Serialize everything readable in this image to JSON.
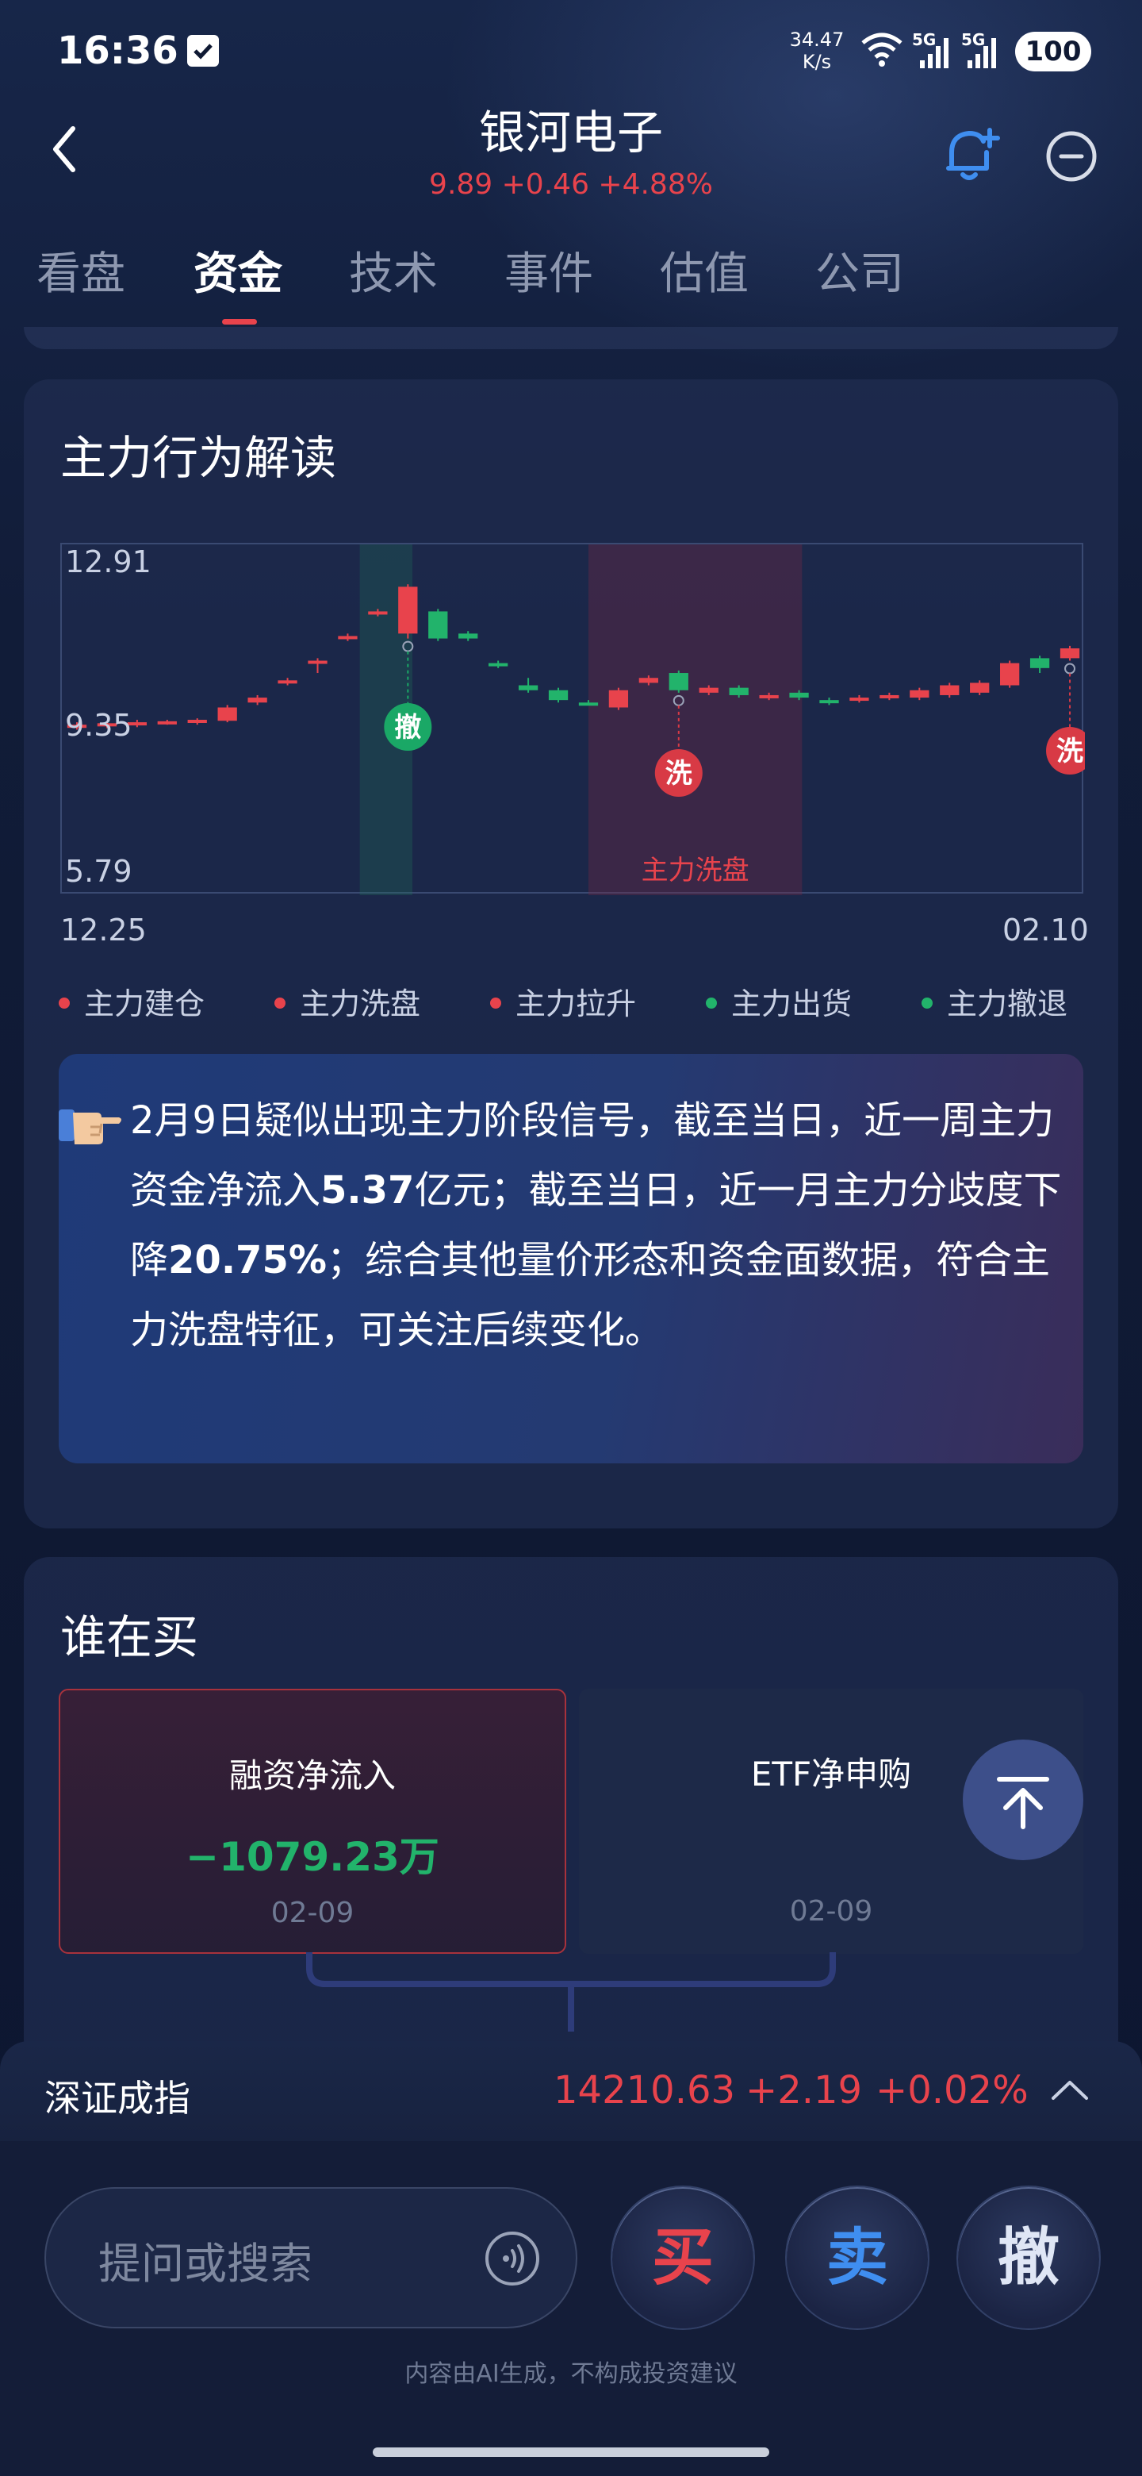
{
  "status": {
    "time": "16:36",
    "net_speed_value": "34.47",
    "net_speed_unit": "K/s",
    "net_type_1": "5G",
    "net_type_2": "5G",
    "battery": "100"
  },
  "header": {
    "title": "银河电子",
    "quote": "9.89 +0.46 +4.88%"
  },
  "tabs": [
    "看盘",
    "资金",
    "技术",
    "事件",
    "估值",
    "公司"
  ],
  "active_tab": "资金",
  "behavior": {
    "title": "主力行为解读",
    "chart_data": {
      "type": "candlestick",
      "y_ticks": [
        "12.91",
        "9.35",
        "5.79"
      ],
      "x_start": "12.25",
      "x_end": "02.10",
      "ylim": [
        5.79,
        12.91
      ],
      "highlight_zone_label": "主力洗盘",
      "markers": [
        {
          "label": "撤",
          "color": "#1aa866"
        },
        {
          "label": "洗",
          "color": "#d83a45"
        },
        {
          "label": "洗",
          "color": "#d83a45"
        }
      ],
      "candles": [
        {
          "o": 9.2,
          "c": 9.25,
          "h": 9.3,
          "l": 9.15
        },
        {
          "o": 9.22,
          "c": 9.28,
          "h": 9.3,
          "l": 9.18
        },
        {
          "o": 9.25,
          "c": 9.3,
          "h": 9.35,
          "l": 9.2
        },
        {
          "o": 9.28,
          "c": 9.32,
          "h": 9.35,
          "l": 9.25
        },
        {
          "o": 9.3,
          "c": 9.35,
          "h": 9.38,
          "l": 9.25
        },
        {
          "o": 9.33,
          "c": 9.6,
          "h": 9.65,
          "l": 9.3
        },
        {
          "o": 9.7,
          "c": 9.8,
          "h": 9.85,
          "l": 9.65
        },
        {
          "o": 10.1,
          "c": 10.15,
          "h": 10.2,
          "l": 10.05
        },
        {
          "o": 10.5,
          "c": 10.55,
          "h": 10.6,
          "l": 10.3
        },
        {
          "o": 11.0,
          "c": 11.05,
          "h": 11.1,
          "l": 10.95
        },
        {
          "o": 11.5,
          "c": 11.55,
          "h": 11.6,
          "l": 11.45
        },
        {
          "o": 11.1,
          "c": 12.05,
          "h": 12.1,
          "l": 11.0
        },
        {
          "o": 11.55,
          "c": 11.0,
          "h": 11.6,
          "l": 10.95
        },
        {
          "o": 11.1,
          "c": 11.0,
          "h": 11.15,
          "l": 10.95
        },
        {
          "o": 10.5,
          "c": 10.45,
          "h": 10.55,
          "l": 10.4
        },
        {
          "o": 10.05,
          "c": 9.95,
          "h": 10.2,
          "l": 9.9
        },
        {
          "o": 9.95,
          "c": 9.75,
          "h": 10.0,
          "l": 9.7
        },
        {
          "o": 9.7,
          "c": 9.68,
          "h": 9.75,
          "l": 9.65
        },
        {
          "o": 9.6,
          "c": 9.95,
          "h": 10.0,
          "l": 9.55
        },
        {
          "o": 10.1,
          "c": 10.2,
          "h": 10.25,
          "l": 10.05
        },
        {
          "o": 10.3,
          "c": 9.95,
          "h": 10.35,
          "l": 9.9
        },
        {
          "o": 9.9,
          "c": 10.0,
          "h": 10.05,
          "l": 9.85
        },
        {
          "o": 10.0,
          "c": 9.85,
          "h": 10.05,
          "l": 9.8
        },
        {
          "o": 9.8,
          "c": 9.85,
          "h": 9.9,
          "l": 9.75
        },
        {
          "o": 9.9,
          "c": 9.8,
          "h": 9.95,
          "l": 9.75
        },
        {
          "o": 9.75,
          "c": 9.7,
          "h": 9.8,
          "l": 9.65
        },
        {
          "o": 9.75,
          "c": 9.8,
          "h": 9.85,
          "l": 9.7
        },
        {
          "o": 9.8,
          "c": 9.85,
          "h": 9.9,
          "l": 9.75
        },
        {
          "o": 9.8,
          "c": 9.95,
          "h": 10.0,
          "l": 9.75
        },
        {
          "o": 9.85,
          "c": 10.05,
          "h": 10.1,
          "l": 9.8
        },
        {
          "o": 9.9,
          "c": 10.1,
          "h": 10.15,
          "l": 9.85
        },
        {
          "o": 10.05,
          "c": 10.5,
          "h": 10.55,
          "l": 10.0
        },
        {
          "o": 10.6,
          "c": 10.4,
          "h": 10.65,
          "l": 10.3
        },
        {
          "o": 10.6,
          "c": 10.8,
          "h": 10.85,
          "l": 10.55
        }
      ],
      "up_color": "#e8434c",
      "down_color": "#22b36b"
    },
    "legend": [
      {
        "label": "主力建仓",
        "color": "#e8434c"
      },
      {
        "label": "主力洗盘",
        "color": "#e8434c"
      },
      {
        "label": "主力拉升",
        "color": "#e8434c"
      },
      {
        "label": "主力出货",
        "color": "#22b36b"
      },
      {
        "label": "主力撤退",
        "color": "#22b36b"
      }
    ],
    "insight": {
      "p1": "2月9日疑似出现主力阶段信号，截至当日，近一周主力资金净流入",
      "v1": "5.37",
      "p2": "亿元；截至当日，近一月主力分歧度下降",
      "v2": "20.75%",
      "p3": "；综合其他量价形态和资金面数据，符合主力洗盘特征，可关注后续变化。"
    }
  },
  "who_buys": {
    "title": "谁在买",
    "margin": {
      "title": "融资净流入",
      "value": "−1079.23万",
      "date": "02-09"
    },
    "etf": {
      "title": "ETF净申购",
      "date": "02-09"
    }
  },
  "index_bar": {
    "name": "深证成指",
    "value": "14210.63",
    "change": "+2.19",
    "pct": "+0.02%"
  },
  "bottom": {
    "search_placeholder": "提问或搜索",
    "buy": "买",
    "sell": "卖",
    "cancel": "撤",
    "disclaimer": "内容由AI生成，不构成投资建议"
  }
}
